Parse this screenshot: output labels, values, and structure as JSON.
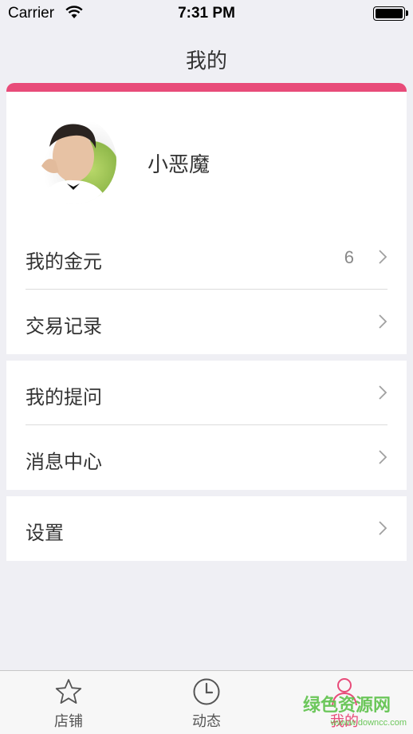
{
  "status_bar": {
    "carrier": "Carrier",
    "time": "7:31 PM"
  },
  "nav": {
    "title": "我的"
  },
  "profile": {
    "username": "小恶魔"
  },
  "menu": {
    "gold": {
      "label": "我的金元",
      "value": "6"
    },
    "transactions": {
      "label": "交易记录"
    },
    "questions": {
      "label": "我的提问"
    },
    "messages": {
      "label": "消息中心"
    },
    "settings": {
      "label": "设置"
    }
  },
  "tabs": [
    {
      "label": "店铺",
      "icon": "star-icon",
      "active": false
    },
    {
      "label": "动态",
      "icon": "clock-icon",
      "active": false
    },
    {
      "label": "我的",
      "icon": "person-icon",
      "active": true
    }
  ],
  "colors": {
    "accent": "#e84b79",
    "background": "#efeff4"
  },
  "watermark": {
    "text": "绿色资源网",
    "sub": "wwww.downcc.com"
  }
}
